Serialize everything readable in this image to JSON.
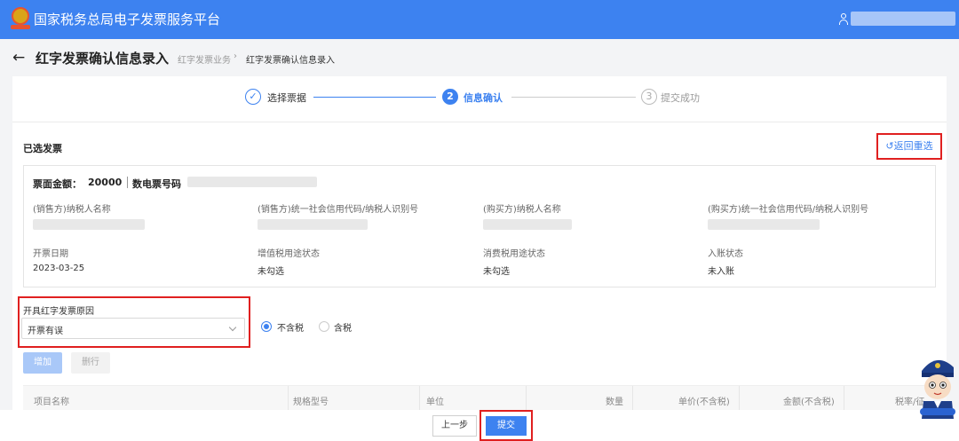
{
  "header": {
    "app_title": "国家税务总局电子发票服务平台",
    "logo_icon": "tax-emblem-icon",
    "user_icon": "user-icon"
  },
  "page": {
    "title": "红字发票确认信息录入",
    "back_icon": "←",
    "breadcrumb": [
      "红字发票业务",
      "红字发票确认信息录入"
    ],
    "breadcrumb_sep": "›"
  },
  "steps": [
    {
      "index": "✓",
      "label": "选择票据",
      "state": "done"
    },
    {
      "index": "2",
      "label": "信息确认",
      "state": "active"
    },
    {
      "index": "3",
      "label": "提交成功",
      "state": "pending"
    }
  ],
  "selected": {
    "section_title": "已选发票",
    "reselect_label": "↺返回重选",
    "amount_label": "票面金额：",
    "amount_value": "20000",
    "invoice_no_label": "数电票号码",
    "fields": [
      {
        "label": "(销售方)纳税人名称",
        "value": ""
      },
      {
        "label": "(销售方)统一社会信用代码/纳税人识别号",
        "value": ""
      },
      {
        "label": "(购买方)纳税人名称",
        "value": ""
      },
      {
        "label": "(购买方)统一社会信用代码/纳税人识别号",
        "value": ""
      },
      {
        "label": "开票日期",
        "value": "2023-03-25"
      },
      {
        "label": "增值税用途状态",
        "value": "未勾选"
      },
      {
        "label": "消费税用途状态",
        "value": "未勾选"
      },
      {
        "label": "入账状态",
        "value": "未入账"
      }
    ]
  },
  "reason": {
    "label": "开具红字发票原因",
    "value": "开票有误"
  },
  "tax_mode": {
    "options": [
      "不含税",
      "含税"
    ],
    "selected": "不含税"
  },
  "actions": {
    "add": "增加",
    "delete": "删行"
  },
  "table": {
    "columns": [
      "项目名称",
      "规格型号",
      "单位",
      "数量",
      "单价(不含税)",
      "金额(不含税)",
      "税率/征"
    ]
  },
  "footer": {
    "prev": "上一步",
    "submit": "提交"
  },
  "colors": {
    "primary": "#3d82f0",
    "highlight": "#e02020"
  }
}
